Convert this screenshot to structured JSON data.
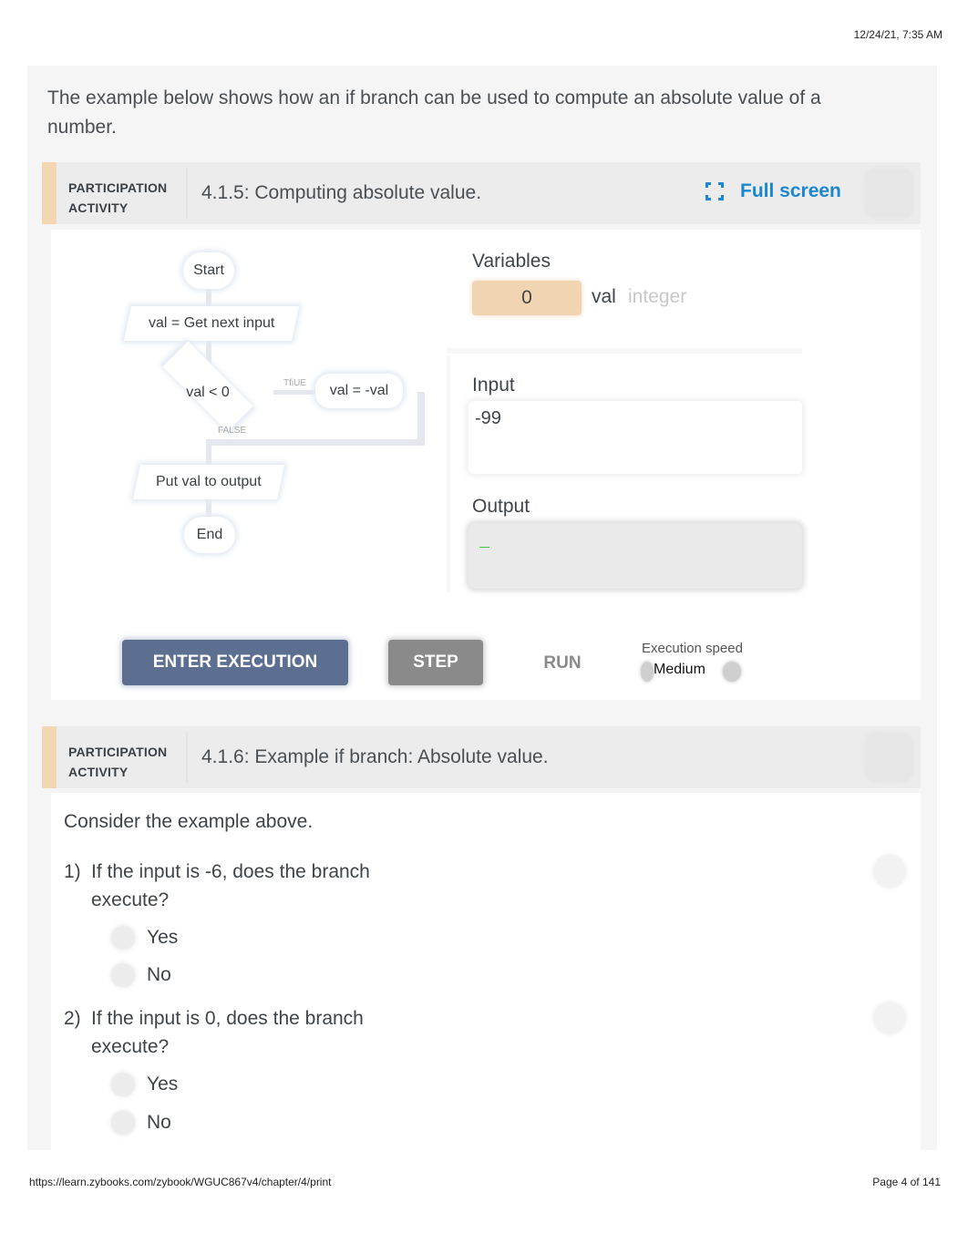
{
  "print_header": {
    "datetime": "12/24/21, 7:35 AM"
  },
  "print_footer": {
    "url": "https://learn.zybooks.com/zybook/WGUC867v4/chapter/4/print",
    "page": "Page 4 of 141"
  },
  "intro": {
    "text": "The example below shows how an if branch can be used to compute an absolute value of a number."
  },
  "activity_1": {
    "label_line1": "PARTICIPATION",
    "label_line2": "ACTIVITY",
    "title": "4.1.5: Computing absolute value.",
    "fullscreen_label": "Full screen",
    "icons": {
      "fullscreen": "fullscreen-icon",
      "completion": "completion-chevron-icon"
    },
    "accent_color": "#f3d6b2",
    "link_color": "#1b87d0",
    "flowchart": {
      "start": "Start",
      "input": "val = Get next input",
      "decision": "val < 0",
      "true_label": "TfiUE",
      "false_label": "FALSE",
      "action": "val = -val",
      "output": "Put val to output",
      "end": "End"
    },
    "variables": {
      "heading": "Variables",
      "items": [
        {
          "value": "0",
          "name": "val",
          "type": "integer"
        }
      ]
    },
    "input": {
      "heading": "Input",
      "value": "-99"
    },
    "output": {
      "heading": "Output",
      "value": ""
    },
    "controls": {
      "enter_execution": "ENTER EXECUTION",
      "step": "STEP",
      "run": "RUN",
      "speed_label": "Execution speed",
      "speed_value": "Medium"
    }
  },
  "activity_2": {
    "label_line1": "PARTICIPATION",
    "label_line2": "ACTIVITY",
    "title": "4.1.6: Example if branch: Absolute value.",
    "intro": "Consider the example above.",
    "questions": [
      {
        "number": "1)",
        "text": "If the input is -6, does the branch execute?",
        "options": [
          "Yes",
          "No"
        ]
      },
      {
        "number": "2)",
        "text": "If the input is 0, does the branch execute?",
        "options": [
          "Yes",
          "No"
        ]
      }
    ]
  }
}
